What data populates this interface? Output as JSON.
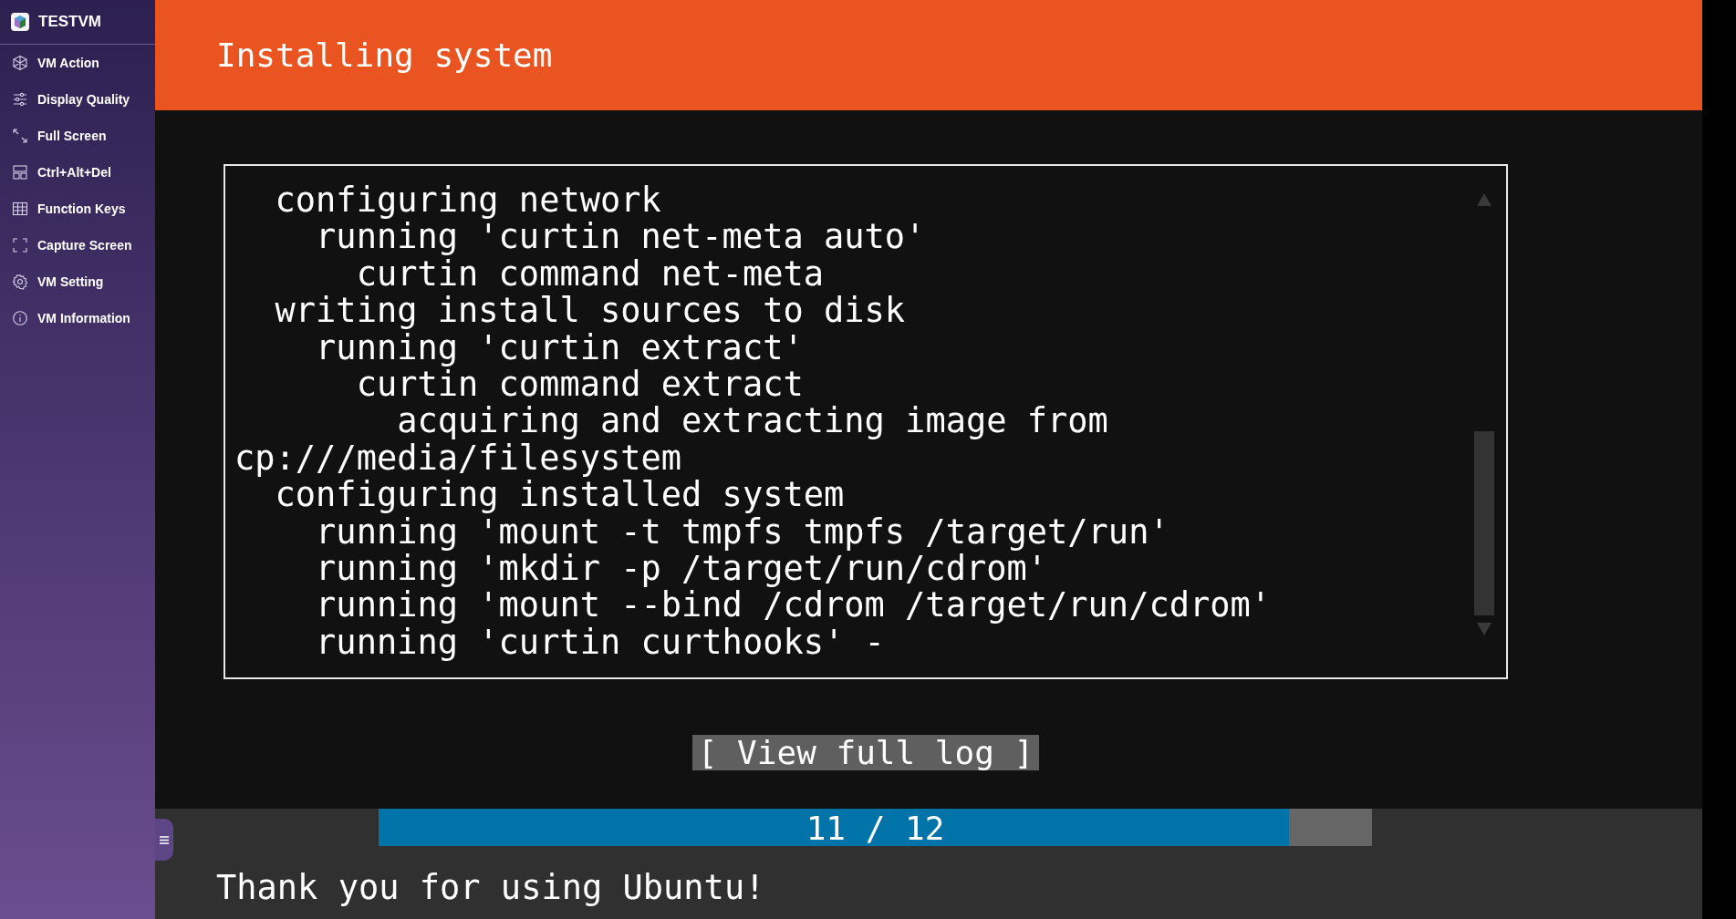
{
  "sidebar": {
    "title": "TESTVM",
    "items": [
      {
        "label": "VM Action"
      },
      {
        "label": "Display Quality"
      },
      {
        "label": "Full Screen"
      },
      {
        "label": "Ctrl+Alt+Del"
      },
      {
        "label": "Function Keys"
      },
      {
        "label": "Capture Screen"
      },
      {
        "label": "VM Setting"
      },
      {
        "label": "VM Information"
      }
    ]
  },
  "screen": {
    "title": "Installing system",
    "log": [
      {
        "text": "configuring network",
        "children": [
          {
            "text": "running 'curtin net-meta auto'",
            "children": [
              {
                "text": "curtin command net-meta"
              }
            ]
          }
        ]
      },
      {
        "text": "writing install sources to disk",
        "children": [
          {
            "text": "running 'curtin extract'",
            "children": [
              {
                "text": "curtin command extract",
                "children": [
                  {
                    "text": "acquiring and extracting image from",
                    "continuation": "cp:///media/filesystem"
                  }
                ]
              }
            ]
          }
        ]
      },
      {
        "text": "configuring installed system",
        "children": [
          {
            "text": "running 'mount -t tmpfs tmpfs /target/run'"
          },
          {
            "text": "running 'mkdir -p /target/run/cdrom'"
          },
          {
            "text": "running 'mount --bind /cdrom /target/run/cdrom'"
          },
          {
            "text": "running 'curtin curthooks' -"
          }
        ]
      }
    ],
    "button": "[ View full log ]",
    "progress": {
      "label": "11 / 12",
      "level": 0.916
    },
    "footer": "Thank you for using Ubuntu!"
  }
}
